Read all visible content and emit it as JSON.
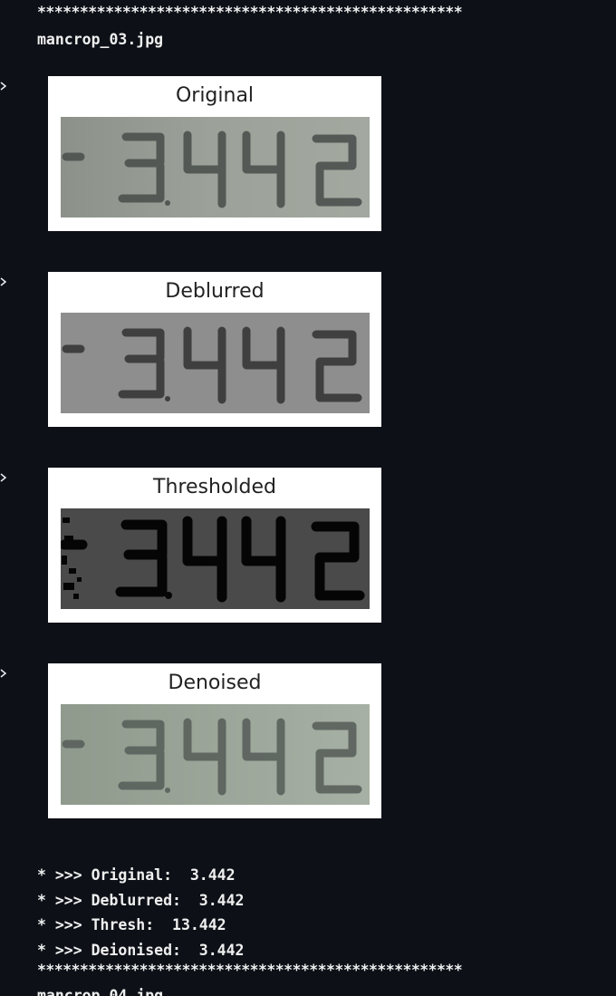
{
  "separator": "**************************************************",
  "filename_current": "mancrop_03.jpg",
  "filename_next": "mancrop_04.jpg",
  "figures": [
    {
      "title": "Original",
      "style": "original"
    },
    {
      "title": "Deblurred",
      "style": "deblurred"
    },
    {
      "title": "Thresholded",
      "style": "thresholded"
    },
    {
      "title": "Denoised",
      "style": "denoised"
    }
  ],
  "display_reading": "-3.442",
  "results": [
    "* >>> Original:  3.442",
    "* >>> Deblurred:  3.442",
    "* >>> Thresh:  13.442",
    "* >>> Deionised:  3.442"
  ],
  "colors": {
    "background": "#0d1117",
    "text": "#f0f0f0",
    "figure_bg": "#ffffff"
  }
}
